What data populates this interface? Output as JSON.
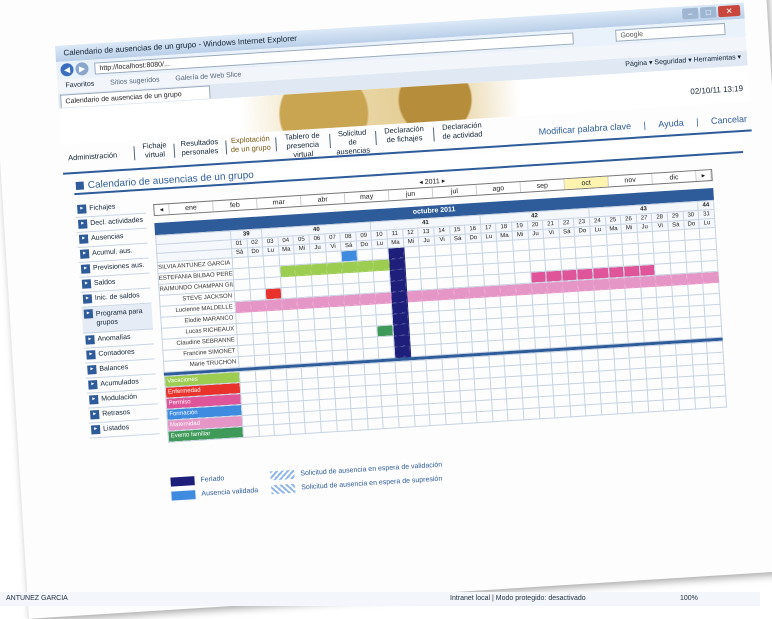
{
  "window": {
    "title": "Calendario de ausencias de un grupo - Windows Internet Explorer",
    "url": "http://localhost:8080/...",
    "search_placeholder": "Google",
    "favorites_label": "Favoritos",
    "fav_item1": "Sitios sugeridos",
    "fav_item2": "Galería de Web Slice",
    "tab_label": "Calendario de ausencias de un grupo",
    "tools_right": "Página ▾   Seguridad ▾   Herramientas ▾",
    "datetime": "02/10/11 13:19"
  },
  "nav": {
    "items": [
      "Administración",
      "Fichaje virtual",
      "Resultados personales",
      "Explotación de un grupo",
      "Tablero de presencia virtual",
      "Solicitud de ausencias",
      "Declaración de fichajes",
      "Declaración de actividad"
    ],
    "right_links": [
      "Modificar palabra clave",
      "Ayuda",
      "Cancelar"
    ]
  },
  "page_title": "Calendario de ausencias de un grupo",
  "sidebar": [
    "Fichajes",
    "Decl. actividades",
    "Ausencias",
    "Acumul. aus.",
    "Previsiones aus.",
    "Saldos",
    "Inic. de saldos",
    "Programa para grupos",
    "Anomalías",
    "Contadores",
    "Balances",
    "Acumulados",
    "Modulación",
    "Retrasos",
    "Listados"
  ],
  "timeline": {
    "year": "◂ 2011 ▸",
    "months": [
      "ene",
      "feb",
      "mar",
      "abr",
      "may",
      "jun",
      "jul",
      "ago",
      "sep",
      "oct",
      "nov",
      "dic"
    ],
    "selected": "oct"
  },
  "calendar": {
    "month_title": "octubre 2011",
    "weeks": [
      "39",
      "40",
      "41",
      "42",
      "43",
      "44"
    ],
    "day_names": [
      "Sá",
      "Do",
      "Lu",
      "Ma",
      "Mi",
      "Ju",
      "Vi",
      "Sá",
      "Do",
      "Lu",
      "Ma",
      "Mi",
      "Ju",
      "Vi",
      "Sá",
      "Do",
      "Lu",
      "Ma",
      "Mi",
      "Ju",
      "Vi",
      "Sá",
      "Do",
      "Lu",
      "Ma",
      "Mi",
      "Ju",
      "Vi",
      "Sá",
      "Do",
      "Lu"
    ],
    "day_nums": [
      "01",
      "02",
      "03",
      "04",
      "05",
      "06",
      "07",
      "08",
      "09",
      "10",
      "11",
      "12",
      "13",
      "14",
      "15",
      "16",
      "17",
      "18",
      "19",
      "20",
      "21",
      "22",
      "23",
      "24",
      "25",
      "26",
      "27",
      "28",
      "29",
      "30",
      "31"
    ],
    "employees": [
      "SILVIA ANTUNEZ GARCIA",
      "ESTEFANIA BILBAO PEREZ",
      "RAIMUNDO CHAMPAN GIL",
      "STEVE JACKSON",
      "Lucienne MALDELLE",
      "Elodie MARANCO",
      "Lucas RICHEAUX",
      "Claudine SEBRANNE",
      "Francine SIMONET",
      "Marie TRUCHON"
    ],
    "absence_types": [
      "Vacaciones",
      "Enfermedad",
      "Permiso",
      "Formación",
      "Maternidad",
      "Evento familiar"
    ]
  },
  "legend": {
    "feriado": "Feriado",
    "validada": "Ausencia validada",
    "espera_validacion": "Solicitud de ausencia en espera de validación",
    "espera_supresion": "Solicitud de ausencia en espera de supresión"
  },
  "status": {
    "left": "ANTUNEZ GARCIA",
    "zone": "Intranet local | Modo protegido: desactivado",
    "zoom": "100%"
  },
  "colors": {
    "accent": "#2e5c9a",
    "vacaciones": "#9ccc50",
    "enfermedad": "#e8322b",
    "permiso": "#e0559a",
    "formacion": "#3f8be0",
    "maternidad": "#e595c6",
    "evento": "#3f9a5a",
    "feriado": "#1d1f7a"
  }
}
